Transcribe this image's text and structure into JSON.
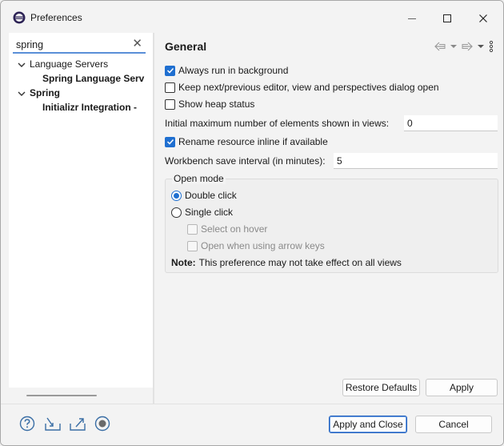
{
  "window": {
    "title": "Preferences",
    "icons": {
      "app": "eclipse-icon",
      "minimize": "minimize-icon",
      "maximize": "maximize-icon",
      "close": "close-icon"
    }
  },
  "filter": {
    "value": "spring",
    "clear_icon": "clear-x-icon"
  },
  "tree": [
    {
      "label": "Language Servers",
      "expanded": true,
      "bold": false
    },
    {
      "label": "Spring Language Serv",
      "bold": true
    },
    {
      "label": "Spring",
      "expanded": true,
      "bold": true
    },
    {
      "label": "Initializr Integration -",
      "bold": true
    }
  ],
  "page": {
    "title": "General",
    "nav_icons": [
      "back-arrow-icon",
      "dropdown-icon",
      "forward-arrow-icon",
      "dropdown-icon",
      "view-menu-icon"
    ],
    "options": {
      "always_run_bg": {
        "label": "Always run in background",
        "checked": true
      },
      "keep_dialog_open": {
        "label": "Keep next/previous editor, view and perspectives dialog open",
        "checked": false
      },
      "show_heap": {
        "label": "Show heap status",
        "checked": false
      },
      "initial_max_label": "Initial maximum number of elements shown in views:",
      "initial_max_value": "0",
      "rename_inline": {
        "label": "Rename resource inline if available",
        "checked": true
      },
      "save_interval_label": "Workbench save interval (in minutes):",
      "save_interval_value": "5"
    },
    "open_mode": {
      "label": "Open mode",
      "double_click": "Double click",
      "single_click": "Single click",
      "select_on_hover": "Select on hover",
      "open_arrow_keys": "Open when using arrow keys",
      "note_bold": "Note:",
      "note_text": "This preference may not take effect on all views",
      "selected": "double_click"
    },
    "restore_defaults": "Restore Defaults",
    "apply": "Apply"
  },
  "footer": {
    "icons": [
      "help-icon",
      "import-icon",
      "export-icon",
      "record-icon"
    ],
    "apply_close": "Apply and Close",
    "cancel": "Cancel"
  },
  "colors": {
    "accent": "#1f6fd0",
    "focus_border": "#1f5fbf"
  }
}
